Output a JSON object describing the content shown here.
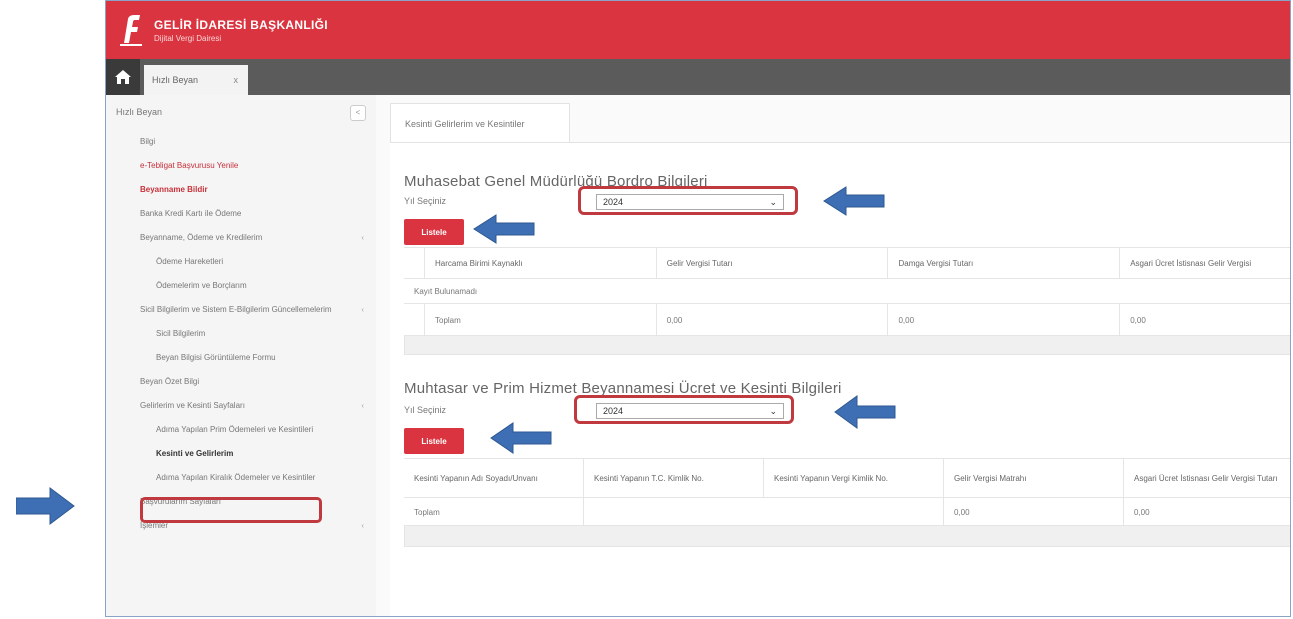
{
  "header": {
    "title": "GELİR İDARESİ BAŞKANLIĞI",
    "subtitle": "Dijital Vergi Dairesi",
    "brand_color": "#d9343f"
  },
  "tabs": {
    "home_icon": "home-icon",
    "active_tab_label": "Hızlı Beyan",
    "close_label": "x"
  },
  "sidebar": {
    "header": "Hızlı Beyan",
    "collapse_label": "<",
    "items": [
      {
        "label": "Bilgi"
      },
      {
        "label": "e-Tebligat Başvurusu Yenile"
      },
      {
        "label": "Beyanname Bildir"
      },
      {
        "label": "Banka Kredi Kartı ile Ödeme"
      },
      {
        "label": "Beyanname, Ödeme ve Kredilerim"
      },
      {
        "label": "Ödeme Hareketleri"
      },
      {
        "label": "Ödemelerim ve Borçlarım"
      },
      {
        "label": "Sicil Bilgilerim ve Sistem E-Bilgilerim Güncellemelerim"
      },
      {
        "label": "Sicil Bilgilerim"
      },
      {
        "label": "Beyan Bilgisi Görüntüleme Formu"
      },
      {
        "label": "Beyan Özet Bilgi"
      },
      {
        "label": "Gelirlerim ve Kesinti Sayfaları"
      },
      {
        "label": "Adıma Yapılan Prim Ödemeleri ve Kesintileri"
      },
      {
        "label": "Kesinti ve Gelirlerim"
      },
      {
        "label": "Adıma Yapılan Kiralık Ödemeler ve Kesintiler"
      },
      {
        "label": "Başvurularım Sayfaları"
      },
      {
        "label": "İşlemler"
      }
    ],
    "highlighted_item": "Kesinti ve Gelirlerim"
  },
  "page": {
    "tab_label": "Kesinti Gelirlerim ve Kesintiler",
    "section1": {
      "title": "Muhasebat Genel Müdürlüğü Bordro Bilgileri",
      "year_label": "Yıl Seçiniz",
      "year_value": "2024",
      "button_label": "Listele",
      "columns": [
        "Harcama Birimi Kaynaklı",
        "Gelir Vergisi Tutarı",
        "Damga Vergisi Tutarı",
        "Asgari Ücret İstisnası Gelir Vergisi"
      ],
      "group_label": "Kayıt Bulunamadı",
      "rows": [
        [
          "Toplam",
          "0,00",
          "0,00",
          "0,00"
        ]
      ]
    },
    "section2": {
      "title": "Muhtasar ve Prim Hizmet Beyannamesi Ücret ve Kesinti Bilgileri",
      "year_label": "Yıl Seçiniz",
      "year_value": "2024",
      "button_label": "Listele",
      "columns": [
        "Kesinti Yapanın Adı Soyadı/Unvanı",
        "Kesinti Yapanın T.C. Kimlik No.",
        "Kesinti Yapanın Vergi Kimlik No.",
        "Gelir Vergisi Matrahı",
        "Asgari Ücret İstisnası Gelir Vergisi Tutarı"
      ],
      "rows": [
        [
          "Toplam",
          "",
          "",
          "0,00",
          "0,00"
        ]
      ]
    }
  },
  "annotations": {
    "highlight_color": "#c0393e",
    "arrow_color": "#3e6fb5",
    "arrow_icon": "arrow-icon"
  }
}
